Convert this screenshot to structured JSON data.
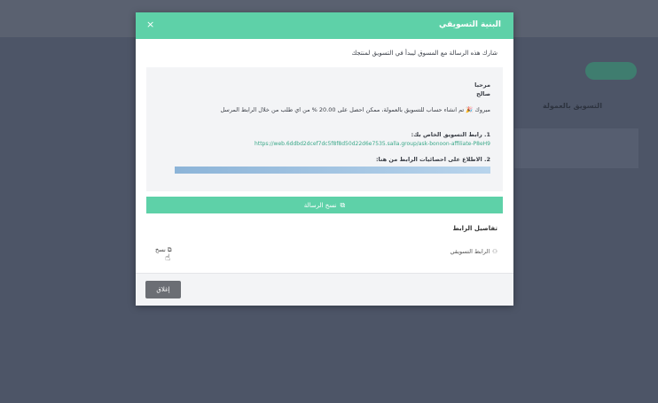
{
  "background": {
    "section_title": "التسويق بالعمولة"
  },
  "modal": {
    "title": "البنية التسويقي",
    "close_icon": "×",
    "intro": "شارك هذه الرسالة مع المسوق ليبدأ في التسويق لمنتجك",
    "message": {
      "greeting": "مرحبا",
      "name": "صالح",
      "body": "مبروك 🎉 تم انشاء حساب للتسويق بالعمولة، ممكن احصل على 20.00 % من اي طلب من خلال الرابط المرسل",
      "link_title": "1. رابط التسويق الخاص بك:",
      "link_url": "https://web.6ddbd2dcef7dc5f8f8d50d22d6e7535.salla.group/ask-bonoon-affiliate-P8eH9",
      "stats_title": "2. الاطلاع على احصائيات الرابط من هنا:"
    },
    "copy_message_label": "نسخ الرسالة",
    "details_title": "تفاصيل الرابط",
    "link_row_label": "الرابط التسويقي",
    "copy_label": "نسخ",
    "close_button_label": "إغلاق"
  },
  "colors": {
    "accent": "#5ed1a8",
    "link": "#3aa889",
    "overlay": "#4a5264"
  }
}
